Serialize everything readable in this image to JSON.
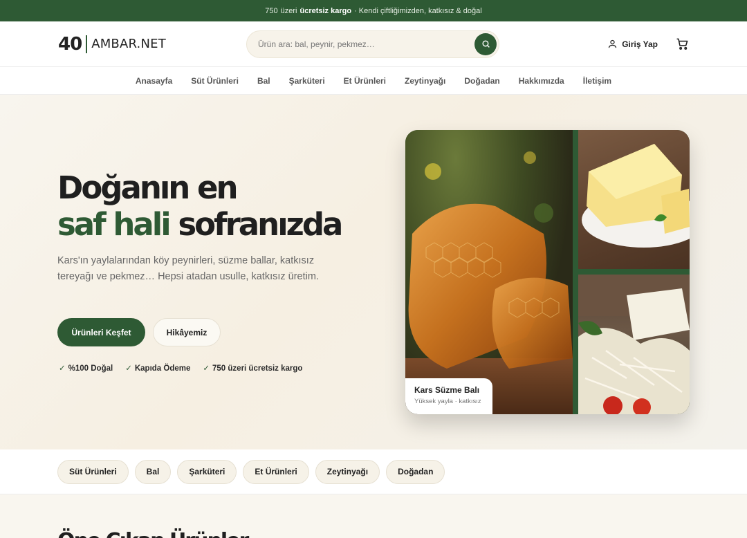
{
  "topbar": {
    "amount": "750",
    "prefix": "üzeri",
    "highlight": "ücretsiz kargo",
    "suffix": "· Kendi çiftliğimizden, katkısız & doğal"
  },
  "header": {
    "logo_number": "40",
    "logo_text": "AMBAR.NET",
    "search_placeholder": "Ürün ara: bal, peynir, pekmez…",
    "login_label": "Giriş Yap"
  },
  "nav": {
    "items": [
      "Anasayfa",
      "Süt Ürünleri",
      "Bal",
      "Şarküteri",
      "Et Ürünleri",
      "Zeytinyağı",
      "Doğadan",
      "Hakkımızda",
      "İletişim"
    ]
  },
  "hero": {
    "title_line1": "Doğanın en",
    "title_green": "saf hali",
    "title_rest": "sofranızda",
    "subtitle": "Kars'ın yaylalarından köy peynirleri, süzme ballar, katkısız tereyağı ve pekmez… Hepsi atadan usulle, katkısız üretim.",
    "primary_button": "Ürünleri Keşfet",
    "secondary_button": "Hikâyemiz",
    "badges": [
      "%100 Doğal",
      "Kapıda Ödeme",
      "750  üzeri ücretsiz kargo"
    ],
    "check_glyph": "✓",
    "card_title": "Kars Süzme Balı",
    "card_subtitle": "Yüksek yayla · katkısız"
  },
  "categories": [
    "Süt Ürünleri",
    "Bal",
    "Şarküteri",
    "Et Ürünleri",
    "Zeytinyağı",
    "Doğadan"
  ],
  "featured": {
    "title": "Öne Çıkan Ürünler"
  },
  "colors": {
    "brand_green": "#2e5a34",
    "cream": "#f6f2e8"
  },
  "icons": [
    "search-icon",
    "user-icon",
    "cart-icon",
    "check-icon"
  ]
}
